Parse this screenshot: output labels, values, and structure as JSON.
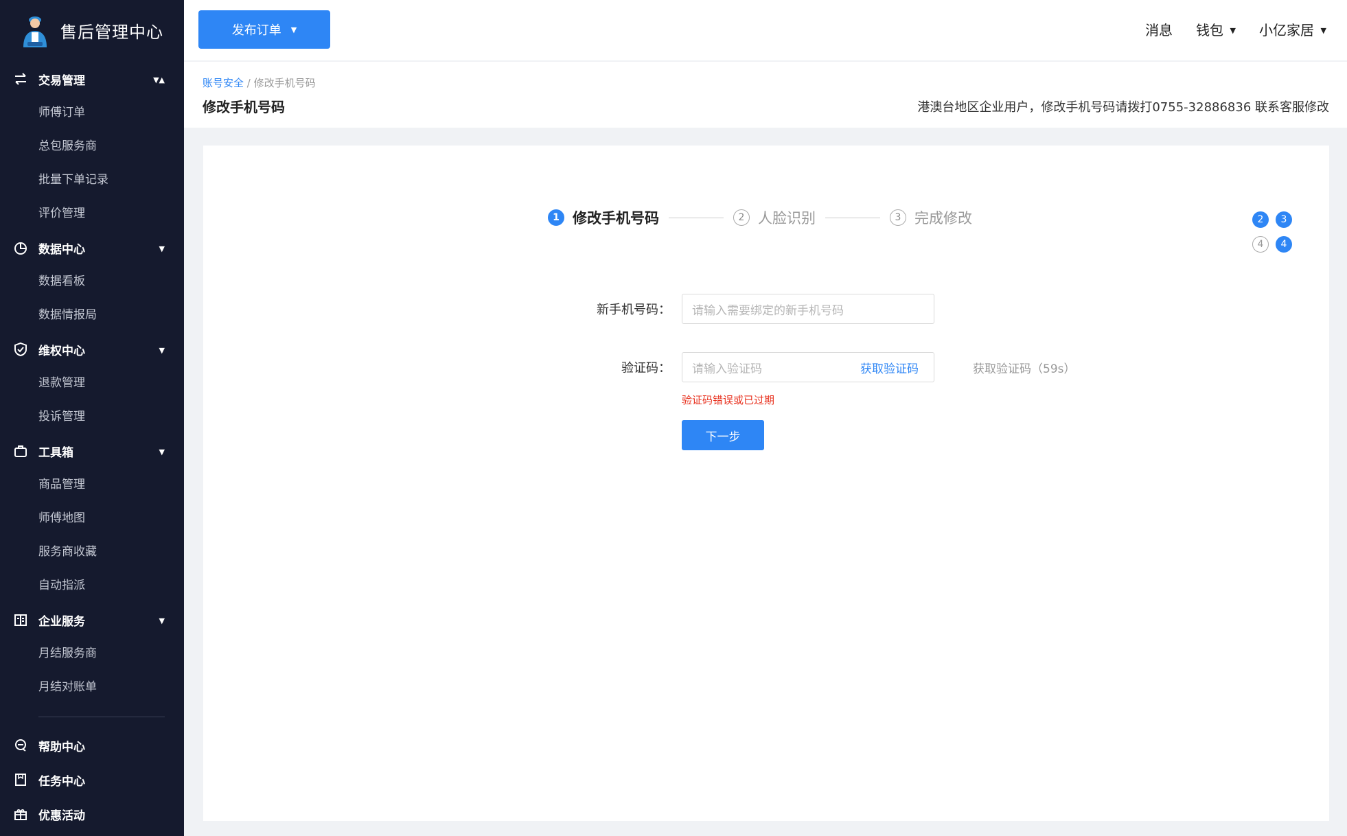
{
  "brand": {
    "title": "售后管理中心"
  },
  "sidebar": {
    "groups": [
      {
        "label": "交易管理",
        "items": [
          "师傅订单",
          "总包服务商",
          "批量下单记录",
          "评价管理"
        ]
      },
      {
        "label": "数据中心",
        "items": [
          "数据看板",
          "数据情报局"
        ]
      },
      {
        "label": "维权中心",
        "items": [
          "退款管理",
          "投诉管理"
        ]
      },
      {
        "label": "工具箱",
        "items": [
          "商品管理",
          "师傅地图",
          "服务商收藏",
          "自动指派"
        ]
      },
      {
        "label": "企业服务",
        "items": [
          "月结服务商",
          "月结对账单"
        ]
      }
    ],
    "bottom": [
      "帮助中心",
      "任务中心",
      "优惠活动"
    ]
  },
  "topbar": {
    "publish": "发布订单",
    "messages": "消息",
    "wallet": "钱包",
    "user": "小亿家居"
  },
  "page": {
    "breadcrumb_link": "账号安全",
    "breadcrumb_sep": " / ",
    "breadcrumb_current": "修改手机号码",
    "title": "修改手机号码",
    "notice": "港澳台地区企业用户，修改手机号码请拨打0755-32886836 联系客服修改"
  },
  "steps": [
    {
      "num": "1",
      "label": "修改手机号码"
    },
    {
      "num": "2",
      "label": "人脸识别"
    },
    {
      "num": "3",
      "label": "完成修改"
    }
  ],
  "mini_steps": [
    "2",
    "3",
    "4",
    "4"
  ],
  "form": {
    "phone_label": "新手机号码：",
    "phone_placeholder": "请输入需要绑定的新手机号码",
    "code_label": "验证码：",
    "code_placeholder": "请输入验证码",
    "get_code": "获取验证码",
    "countdown": "获取验证码（59s）",
    "error": "验证码错误或已过期",
    "next": "下一步"
  }
}
